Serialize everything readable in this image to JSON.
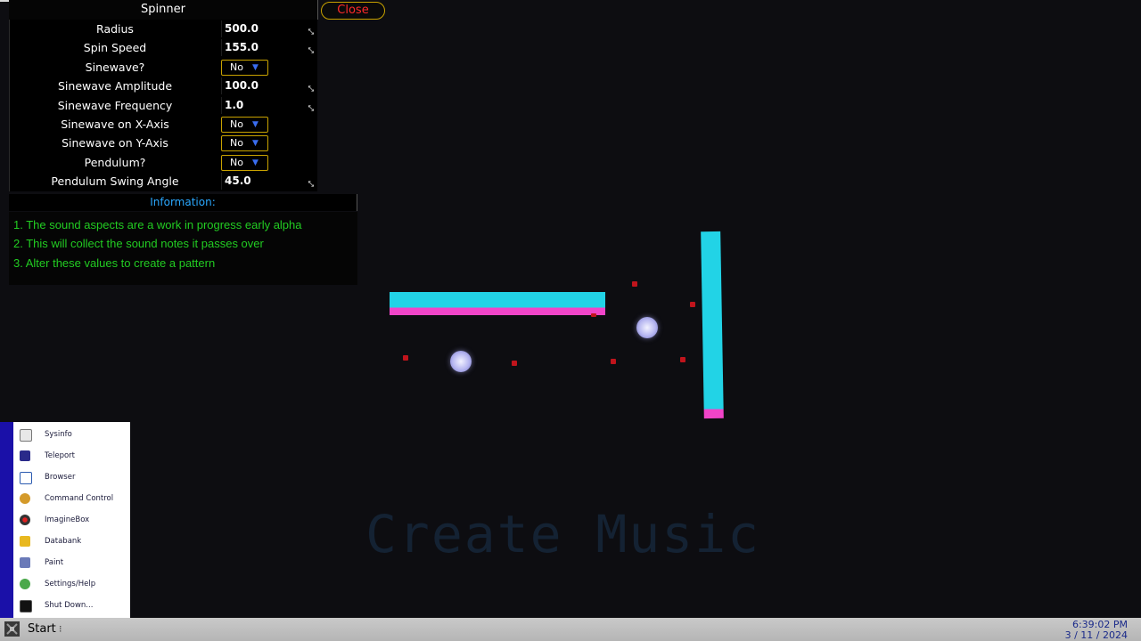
{
  "window": {
    "title": "Spinner",
    "close_label": "Close"
  },
  "settings": [
    {
      "label": "Radius",
      "type": "number",
      "value": "500.0"
    },
    {
      "label": "Spin Speed",
      "type": "number",
      "value": "155.0"
    },
    {
      "label": "Sinewave?",
      "type": "dropdown",
      "value": "No"
    },
    {
      "label": "Sinewave Amplitude",
      "type": "number",
      "value": "100.0"
    },
    {
      "label": "Sinewave Frequency",
      "type": "number",
      "value": "1.0"
    },
    {
      "label": "Sinewave on X-Axis",
      "type": "dropdown",
      "value": "No"
    },
    {
      "label": "Sinewave on Y-Axis",
      "type": "dropdown",
      "value": "No"
    },
    {
      "label": "Pendulum?",
      "type": "dropdown",
      "value": "No"
    },
    {
      "label": "Pendulum Swing Angle",
      "type": "number",
      "value": "45.0"
    }
  ],
  "information": {
    "heading": "Information:",
    "lines": [
      "1. The sound aspects are a work in progress early alpha",
      "2. This will collect the sound notes it passes over",
      "3. Alter these values to create a pattern"
    ]
  },
  "scene": {
    "watermark": "Create Music",
    "colors": {
      "bar": "#22d3e6",
      "bar_edge": "#f044c8",
      "note": "#c0141c",
      "ball": "#c8c8ff"
    }
  },
  "start_menu": {
    "items": [
      {
        "label": "Sysinfo",
        "icon": "sysinfo-icon"
      },
      {
        "label": "Teleport",
        "icon": "teleport-icon"
      },
      {
        "label": "Browser",
        "icon": "browser-icon"
      },
      {
        "label": "Command Control",
        "icon": "command-control-icon"
      },
      {
        "label": "ImagineBox",
        "icon": "imaginebox-icon"
      },
      {
        "label": "Databank",
        "icon": "databank-icon"
      },
      {
        "label": "Paint",
        "icon": "paint-icon"
      },
      {
        "label": "Settings/Help",
        "icon": "settings-help-icon"
      },
      {
        "label": "Shut Down...",
        "icon": "shut-down-icon"
      }
    ]
  },
  "taskbar": {
    "start_label": "Start",
    "time": "6:39:02 PM",
    "date": "3 / 11 / 2024"
  }
}
